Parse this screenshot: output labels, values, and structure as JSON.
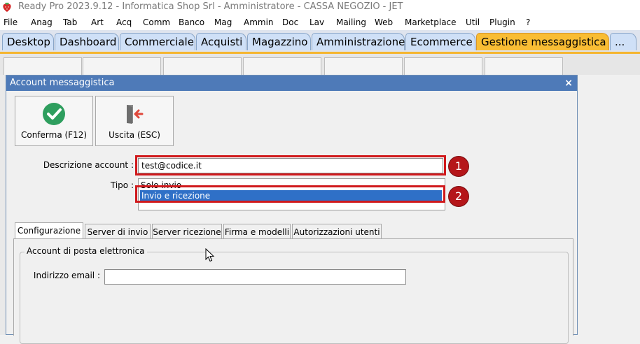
{
  "app": {
    "title": "Ready Pro 2023.9.12 - Informatica Shop Srl - Amministratore - CASSA NEGOZIO - JET"
  },
  "menu": [
    "File",
    "Anag",
    "Tab",
    "Art",
    "Acq",
    "Comm",
    "Banco",
    "Mag",
    "Ammin",
    "Doc",
    "Lav",
    "Mailing",
    "Web",
    "Marketplace",
    "Util",
    "Plugin",
    "?"
  ],
  "tabs": [
    "Desktop",
    "Dashboard",
    "Commerciale",
    "Acquisti",
    "Magazzino",
    "Amministrazione",
    "Ecommerce",
    "Gestione messaggistica",
    "..."
  ],
  "active_tab": "Gestione messaggistica",
  "dialog": {
    "title": "Account messaggistica",
    "close": "×",
    "buttons": {
      "confirm": "Conferma (F12)",
      "exit": "Uscita (ESC)"
    },
    "fields": {
      "description_label": "Descrizione account :",
      "description_value": "test@codice.it",
      "type_label": "Tipo :",
      "type_options": [
        "Solo invio",
        "Invio e ricezione"
      ],
      "type_selected": "Invio e ricezione"
    },
    "annotations": [
      "1",
      "2"
    ],
    "tabs": [
      "Configurazione",
      "Server di invio",
      "Server ricezione",
      "Firma e modelli",
      "Autorizzazioni utenti"
    ],
    "active_tab": "Configurazione",
    "group": {
      "title": "Account di posta elettronica",
      "email_label": "Indirizzo email :",
      "email_value": ""
    }
  },
  "colors": {
    "dialog_title_bg": "#4e7ab8",
    "active_tab_bg": "#f9bd34",
    "annotation_red": "#d0191c",
    "selection_blue": "#2f70c7",
    "confirm_green": "#2e9e5e",
    "exit_red": "#e0483c"
  },
  "icons": {
    "app": "strawberry-icon",
    "confirm": "checkmark-circle-icon",
    "exit": "door-exit-icon",
    "close": "close-icon",
    "cursor": "mouse-pointer-icon"
  }
}
